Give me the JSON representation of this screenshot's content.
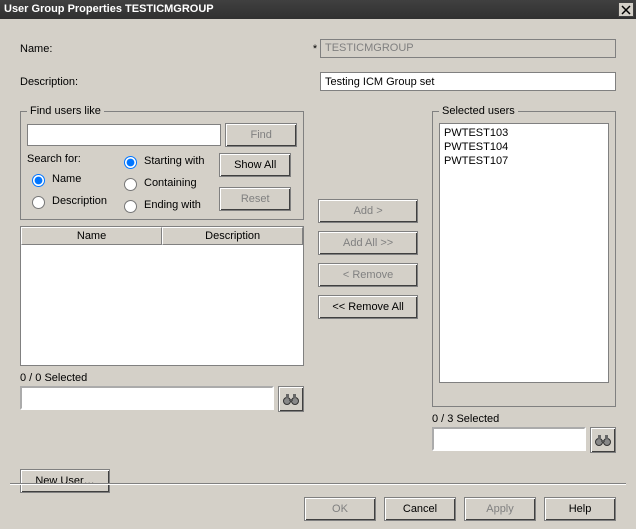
{
  "window": {
    "title": "User Group Properties TESTICMGROUP"
  },
  "fields": {
    "name_label": "Name:",
    "name_required": "*",
    "name_value": "TESTICMGROUP",
    "desc_label": "Description:",
    "desc_value": "Testing ICM Group set"
  },
  "find": {
    "legend": "Find users like",
    "search_value": "",
    "find_btn": "Find",
    "showall_btn": "Show All",
    "reset_btn": "Reset",
    "search_for_label": "Search for:",
    "opt_name": "Name",
    "opt_desc": "Description",
    "opt_start": "Starting with",
    "opt_contain": "Containing",
    "opt_end": "Ending with",
    "col_name": "Name",
    "col_desc": "Description",
    "status": "0 / 0 Selected",
    "filter_value": ""
  },
  "transfer": {
    "add": "Add >",
    "addall": "Add All >>",
    "remove": "< Remove",
    "removeall": "<< Remove All"
  },
  "selected": {
    "legend": "Selected users",
    "items": [
      "PWTEST103",
      "PWTEST104",
      "PWTEST107"
    ],
    "status": "0 / 3 Selected",
    "filter_value": ""
  },
  "newuser_btn": "New User…",
  "footer": {
    "ok": "OK",
    "cancel": "Cancel",
    "apply": "Apply",
    "help": "Help"
  }
}
